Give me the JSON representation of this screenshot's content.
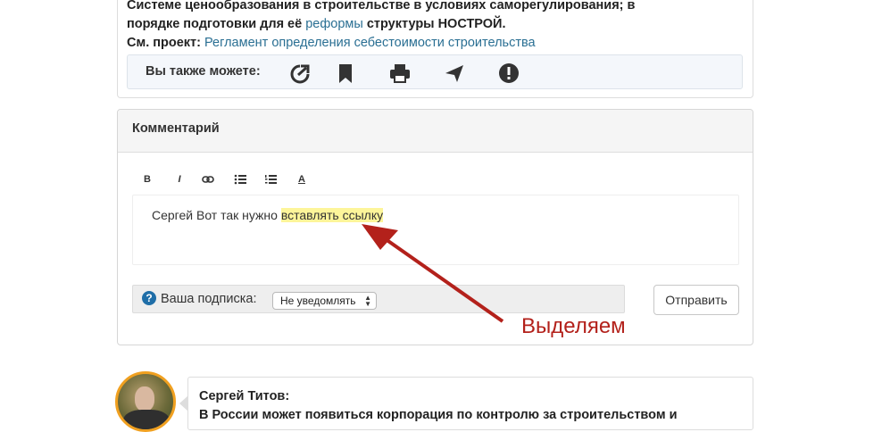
{
  "article": {
    "line1": "Системе ценообразования в строительстве в условиях саморегулирования; в",
    "line2_pre": "порядке подготовки для её ",
    "line2_link": "реформы",
    "line2_post": " структуры НОСТРОЙ.",
    "project_label": "См. проект:",
    "project_link": "Регламент определения себестоимости строительства"
  },
  "share": {
    "label": "Вы также можете:",
    "icons": [
      "share-icon",
      "bookmark-icon",
      "print-icon",
      "send-icon",
      "report-icon"
    ]
  },
  "comment": {
    "title": "Комментарий",
    "toolbar": {
      "bold": "B",
      "italic": "I",
      "color": "A"
    },
    "editor_text_pre": "Сергей Вот так нужно ",
    "editor_text_selected": "вставлять ссылку",
    "subscription_label": "Ваша подписка:",
    "subscription_value": "Не уведомлять",
    "help": "?",
    "send_label": "Отправить"
  },
  "annotation": {
    "text": "Выделяем",
    "color": "#b3211b"
  },
  "next_comment": {
    "author": "Сергей Титов:",
    "text_partial": "В России может появиться корпорация по контролю за строительством и"
  },
  "colors": {
    "link": "#2a6f93",
    "highlight": "#fdf59a",
    "help_icon": "#1f6ea8",
    "avatar_ring": "#f0a020"
  }
}
